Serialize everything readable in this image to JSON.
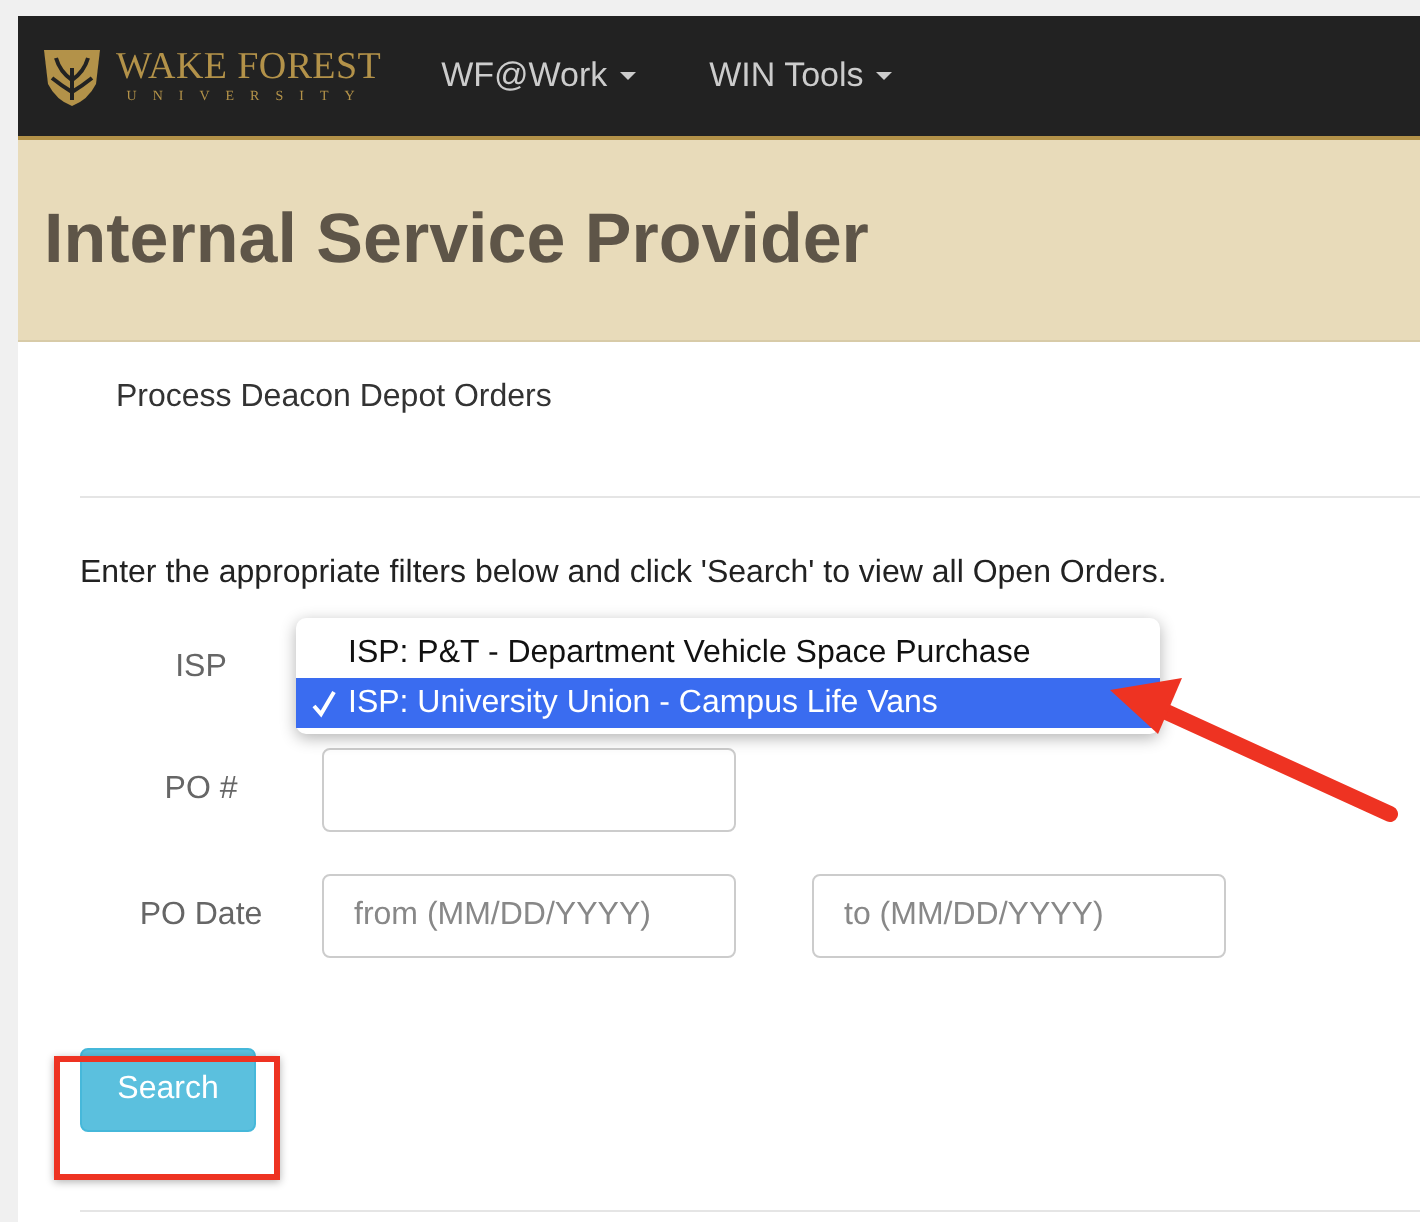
{
  "navbar": {
    "brand": {
      "name": "WAKE FOREST",
      "subtitle": "UNIVERSITY"
    },
    "menus": [
      {
        "label": "WF@Work"
      },
      {
        "label": "WIN Tools"
      }
    ]
  },
  "header": {
    "title": "Internal Service Provider"
  },
  "breadcrumb": "Process Deacon Depot Orders",
  "instructions": "Enter the appropriate filters below and click 'Search' to view all Open Orders.",
  "form": {
    "isp": {
      "label": "ISP",
      "options": [
        {
          "label": "ISP: P&T - Department Vehicle Space Purchase",
          "selected": false
        },
        {
          "label": "ISP: University Union - Campus Life Vans",
          "selected": true
        }
      ]
    },
    "po_number": {
      "label": "PO #"
    },
    "po_date": {
      "label": "PO Date",
      "from_placeholder": "from (MM/DD/YYYY)",
      "to_placeholder": "to (MM/DD/YYYY)"
    },
    "search_button": "Search"
  }
}
